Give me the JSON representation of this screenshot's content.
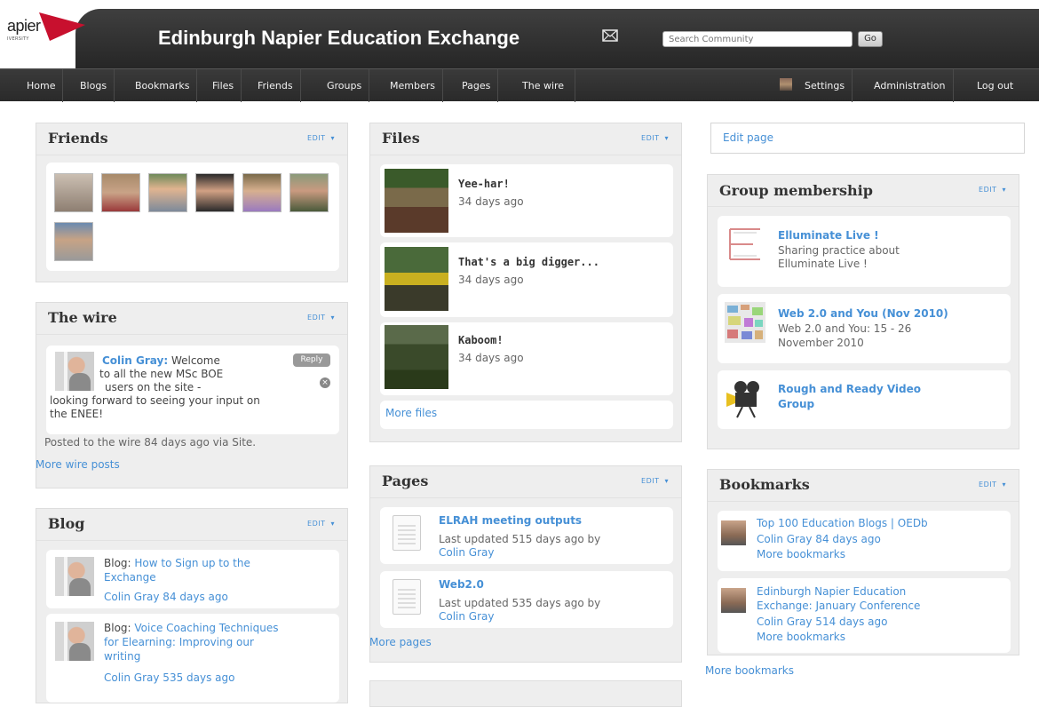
{
  "header": {
    "logo_text": "apier",
    "logo_sub": "IVERSITY",
    "site_title": "Edinburgh Napier Education Exchange",
    "search_placeholder": "Search Community",
    "search_button": "Go"
  },
  "nav": {
    "left": [
      "Home",
      "Blogs",
      "Bookmarks",
      "Files",
      "Friends",
      "Groups",
      "Members",
      "Pages",
      "The wire"
    ],
    "right": [
      "Settings",
      "Administration",
      "Log out"
    ]
  },
  "common": {
    "edit_label": "EDIT",
    "caret": "▾"
  },
  "friends": {
    "title": "Friends"
  },
  "wire": {
    "title": "The wire",
    "post_author": "Colin Gray:",
    "post_text_1": "Welcome",
    "post_text_2": "to all the new MSc BOE",
    "post_text_3": "users on the site -",
    "post_text_4": "looking forward to seeing your input on",
    "post_text_5": "the ENEE!",
    "reply_label": "Reply",
    "posted": "Posted to the wire 84 days ago via Site.",
    "more": "More wire posts"
  },
  "blog": {
    "title": "Blog",
    "items": [
      {
        "prefix": "Blog:",
        "title_1": "How to Sign up to the",
        "title_2": "Exchange",
        "meta": "Colin Gray 84 days ago"
      },
      {
        "prefix": "Blog:",
        "title_1": "Voice Coaching Techniques",
        "title_2": "for Elearning: Improving our",
        "title_3": "writing",
        "meta": "Colin Gray 535 days ago"
      }
    ]
  },
  "files": {
    "title": "Files",
    "items": [
      {
        "name": "Yee-har!",
        "date": "34 days ago"
      },
      {
        "name": "That's a big digger...",
        "date": "34 days ago"
      },
      {
        "name": "Kaboom!",
        "date": "34 days ago"
      }
    ],
    "more": "More files"
  },
  "pages": {
    "title": "Pages",
    "items": [
      {
        "name": "ELRAH meeting outputs",
        "meta_1": "Last updated 515 days ago by",
        "meta_2": "Colin Gray"
      },
      {
        "name": "Web2.0",
        "meta_1": "Last updated 535 days ago by",
        "meta_2": "Colin Gray"
      }
    ],
    "more": "More pages"
  },
  "edit_page": "Edit page",
  "groups": {
    "title": "Group membership",
    "items": [
      {
        "name": "Elluminate Live !",
        "desc_1": "Sharing practice about",
        "desc_2": "Elluminate Live !"
      },
      {
        "name": "Web 2.0 and You (Nov 2010)",
        "desc_1": "Web 2.0 and You: 15 - 26",
        "desc_2": "November 2010"
      },
      {
        "name_1": "Rough and Ready Video",
        "name_2": "Group"
      }
    ]
  },
  "bookmarks": {
    "title": "Bookmarks",
    "items": [
      {
        "title_1": "Top 100 Education Blogs | OEDb",
        "meta": "Colin Gray 84 days ago",
        "more": "More bookmarks"
      },
      {
        "title_1": "Edinburgh Napier Education",
        "title_2": "Exchange: January Conference",
        "meta": "Colin Gray 514 days ago",
        "more": "More bookmarks"
      }
    ],
    "more": "More bookmarks"
  },
  "colors": {
    "link": "#4690d6",
    "nav_bg": "#2e2e2e",
    "panel_bg": "#eeeeee",
    "logo_red": "#c8102e"
  }
}
